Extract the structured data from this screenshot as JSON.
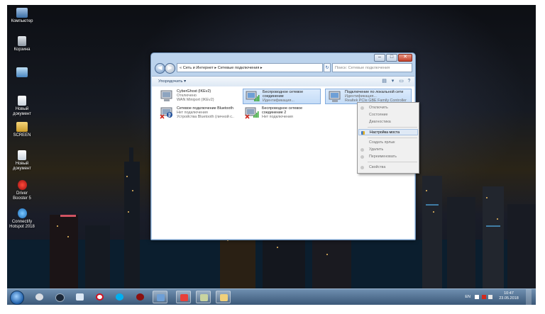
{
  "desktop": {
    "icons": [
      {
        "label": "Компьютер",
        "icon": "computer-icon"
      },
      {
        "label": "Корзина",
        "icon": "recycle-bin-icon"
      },
      {
        "label": "",
        "icon": "folder-icon"
      },
      {
        "label": "Новый документ",
        "icon": "document-icon"
      },
      {
        "label": "SCREEN",
        "icon": "screen-folder-icon"
      },
      {
        "label": "Новый документ",
        "icon": "document-icon"
      },
      {
        "label": "Driver Booster 5",
        "icon": "driver-booster-icon"
      },
      {
        "label": "Connectify Hotspot 2018",
        "icon": "connectify-icon"
      }
    ]
  },
  "window": {
    "address": "Сеть и Интернет ▸ Сетевые подключения ▸",
    "address_parts": [
      "«",
      "Сеть и Интернет",
      "▸",
      "Сетевые подключения",
      "▸"
    ],
    "search_placeholder": "Поиск: Сетевые подключения",
    "organize_label": "Упорядочить ▾",
    "caption": {
      "minimize": "–",
      "maximize": "□",
      "close": "✕"
    },
    "connections": [
      {
        "name": "CyberGhost (IKEv2)",
        "status": "Отключено",
        "device": "WAN Miniport (IKEv2)",
        "selected": false
      },
      {
        "name": "Беспроводное сетевое соединение",
        "status": "",
        "device": "Идентификация...",
        "selected": true
      },
      {
        "name": "Подключение по локальной сети",
        "status": "Идентификация...",
        "device": "Realtek PCIe GBE Family Controller",
        "selected": true
      },
      {
        "name": "Сетевое подключение Bluetooth",
        "status": "Нет подключения",
        "device": "Устройства Bluetooth (личной с...",
        "selected": false
      },
      {
        "name": "Беспроводное сетевое соединение 2",
        "status": "Нет подключения",
        "device": "",
        "selected": false
      }
    ]
  },
  "context_menu": {
    "items": [
      {
        "label": "Отключить",
        "enabled": false
      },
      {
        "label": "Состояние",
        "enabled": false
      },
      {
        "label": "Диагностика",
        "enabled": false
      },
      {
        "label": "Настройка моста",
        "enabled": true,
        "highlighted": true
      },
      {
        "label": "Создать ярлык",
        "enabled": false
      },
      {
        "label": "Удалить",
        "enabled": false
      },
      {
        "label": "Переименовать",
        "enabled": false
      },
      {
        "label": "Свойства",
        "enabled": false
      }
    ]
  },
  "taskbar": {
    "language": "EN",
    "time": "10:47",
    "date": "23.05.2018",
    "apps": [
      "explorer",
      "steam",
      "notepad",
      "opera",
      "skype",
      "media",
      "network-center",
      "paint",
      "settings",
      "folder"
    ]
  },
  "colors": {
    "selection": "#c4dcf7",
    "taskbar": "#3b5878",
    "window_frame": "#bcd3ec",
    "menu_highlight": "#dfe9f5"
  }
}
